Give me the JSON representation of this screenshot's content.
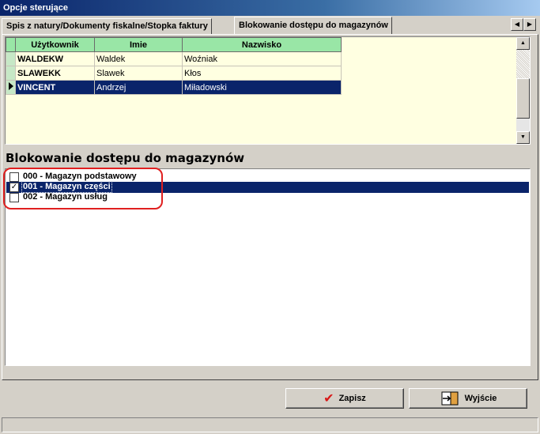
{
  "window": {
    "title": "Opcje sterujące"
  },
  "tabs": [
    {
      "label": "Spis z natury/Dokumenty fiskalne/Stopka faktury"
    },
    {
      "label": "Blokowanie dostępu do magazynów"
    }
  ],
  "users_grid": {
    "columns": [
      "Użytkownik",
      "Imie",
      "Nazwisko"
    ],
    "rows": [
      {
        "login": "WALDEKW",
        "first_name": "Waldek",
        "last_name": "Woźniak"
      },
      {
        "login": "SLAWEKK",
        "first_name": "Slawek",
        "last_name": "Kłos"
      },
      {
        "login": "VINCENT",
        "first_name": "Andrzej",
        "last_name": "Miładowski"
      }
    ],
    "selected_row": 2
  },
  "section_title": "Blokowanie dostępu do magazynów",
  "warehouses": [
    {
      "label": "000 - Magazyn podstawowy",
      "checked": false
    },
    {
      "label": "001 - Magazyn części",
      "checked": true
    },
    {
      "label": "002 - Magazyn usług",
      "checked": false
    }
  ],
  "buttons": {
    "save": "Zapisz",
    "exit": "Wyjście"
  },
  "colors": {
    "selection": "#0a246a",
    "grid_header": "#99e6a6",
    "grid_background": "#ffffe1",
    "highlight": "#e02020"
  }
}
